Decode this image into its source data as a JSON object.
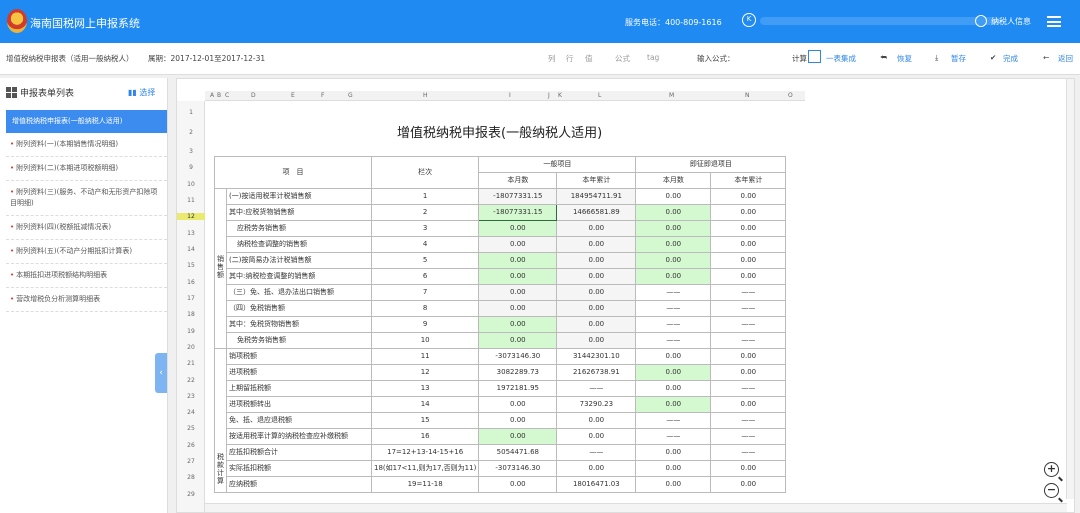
{
  "header": {
    "app_title": "海南国税网上申报系统",
    "phone": "服务电话：400-809-1616",
    "k_icon": "K",
    "user_label": "纳税人信息",
    "brand_color": "#1f8af2"
  },
  "toolbar": {
    "form_title": "增值税纳税申报表（适用一般纳税人）",
    "period": "属期：2017-12-01至2017-12-31",
    "col": "列",
    "row": "行",
    "val": "值",
    "formula": "公式",
    "tag": "tag",
    "input_formula": "输入公式：",
    "calc": "计算",
    "one_table": "一表集成",
    "restore": "恢复",
    "save": "暂存",
    "done": "完成",
    "back": "返回"
  },
  "sidebar": {
    "title": "申报表单列表",
    "choose": "选择",
    "items": [
      {
        "label": "增值税纳税申报表(一般纳税人适用)",
        "active": true
      },
      {
        "label": "附列资料(一)(本期销售情况明细)"
      },
      {
        "label": "附列资料(二)(本期进项税额明细)"
      },
      {
        "label": "附列资料(三)(服务、不动产和无形资产扣除项目明细)"
      },
      {
        "label": "附列资料(四)(税额抵减情况表)"
      },
      {
        "label": "附列资料(五)(不动产分期抵扣计算表)"
      },
      {
        "label": "本期抵扣进项税额结构明细表"
      },
      {
        "label": "营改增税负分析测算明细表"
      }
    ]
  },
  "sheet": {
    "columns": [
      "A",
      "B",
      "C",
      "D",
      "E",
      "F",
      "G",
      "H",
      "I",
      "J",
      "K",
      "L",
      "M",
      "N",
      "O"
    ],
    "row_numbers": [
      "1",
      "2",
      "3",
      "9",
      "10",
      "11",
      "12",
      "13",
      "14",
      "15",
      "16",
      "17",
      "18",
      "19",
      "20",
      "21",
      "22",
      "23",
      "24",
      "25",
      "26",
      "27",
      "28",
      "29"
    ],
    "selected_row": "12",
    "title": "增值税纳税申报表(一般纳税人适用)",
    "headers": {
      "item": "项　目",
      "line": "栏次",
      "general": "一般项目",
      "immediate": "即征即退项目",
      "month": "本月数",
      "year": "本年累计"
    },
    "sections": [
      {
        "label": "销售额",
        "rows": 10
      },
      {
        "label": "税款计算",
        "rows": 9
      }
    ],
    "rows": [
      {
        "item": "(一)按适用税率计税销售额",
        "line": "1",
        "v": [
          "-18077331.15",
          "184954711.91",
          "0.00",
          "0.00"
        ],
        "green": []
      },
      {
        "item": "其中:应税货物销售额",
        "line": "2",
        "v": [
          "-18077331.15",
          "14666581.89",
          "0.00",
          "0.00"
        ],
        "green": [
          0,
          2
        ],
        "selected": 0
      },
      {
        "item": "应税劳务销售额",
        "line": "3",
        "v": [
          "0.00",
          "0.00",
          "0.00",
          "0.00"
        ],
        "green": [
          0,
          2
        ],
        "indent": true
      },
      {
        "item": "纳税检查调整的销售额",
        "line": "4",
        "v": [
          "0.00",
          "0.00",
          "0.00",
          "0.00"
        ],
        "green": [
          2
        ],
        "indent": true
      },
      {
        "item": "(二)按简易办法计税销售额",
        "line": "5",
        "v": [
          "0.00",
          "0.00",
          "0.00",
          "0.00"
        ],
        "green": [
          0,
          2
        ]
      },
      {
        "item": "其中:纳税检查调整的销售额",
        "line": "6",
        "v": [
          "0.00",
          "0.00",
          "0.00",
          "0.00"
        ],
        "green": [
          0,
          2
        ]
      },
      {
        "item": "（三）免、抵、退办法出口销售额",
        "line": "7",
        "v": [
          "0.00",
          "0.00",
          "——",
          "——"
        ],
        "green": []
      },
      {
        "item": "（四）免税销售额",
        "line": "8",
        "v": [
          "0.00",
          "0.00",
          "——",
          "——"
        ],
        "green": []
      },
      {
        "item": "其中：免税货物销售额",
        "line": "9",
        "v": [
          "0.00",
          "0.00",
          "——",
          "——"
        ],
        "green": [
          0
        ]
      },
      {
        "item": "免税劳务销售额",
        "line": "10",
        "v": [
          "0.00",
          "0.00",
          "——",
          "——"
        ],
        "green": [
          0
        ],
        "indent": true
      },
      {
        "item": "销项税额",
        "line": "11",
        "v": [
          "-3073146.30",
          "31442301.10",
          "0.00",
          "0.00"
        ],
        "green": []
      },
      {
        "item": "进项税额",
        "line": "12",
        "v": [
          "3082289.73",
          "21626738.91",
          "0.00",
          "0.00"
        ],
        "green": [
          2
        ]
      },
      {
        "item": "上期留抵税额",
        "line": "13",
        "v": [
          "1972181.95",
          "——",
          "0.00",
          "——"
        ],
        "green": []
      },
      {
        "item": "进项税额转出",
        "line": "14",
        "v": [
          "0.00",
          "73290.23",
          "0.00",
          "0.00"
        ],
        "green": [
          2
        ]
      },
      {
        "item": "免、抵、退应退税额",
        "line": "15",
        "v": [
          "0.00",
          "0.00",
          "——",
          "——"
        ],
        "green": []
      },
      {
        "item": "按适用税率计算的纳税检查应补缴税额",
        "line": "16",
        "v": [
          "0.00",
          "0.00",
          "——",
          "——"
        ],
        "green": [
          0
        ]
      },
      {
        "item": "应抵扣税额合计",
        "line": "17=12+13-14-15+16",
        "v": [
          "5054471.68",
          "——",
          "0.00",
          "——"
        ],
        "green": []
      },
      {
        "item": "实际抵扣税额",
        "line": "18(如17<11,则为17,否则为11)",
        "v": [
          "-3073146.30",
          "0.00",
          "0.00",
          "0.00"
        ],
        "green": []
      },
      {
        "item": "应纳税额",
        "line": "19=11-18",
        "v": [
          "0.00",
          "18016471.03",
          "0.00",
          "0.00"
        ],
        "green": []
      }
    ],
    "highlight_color": "#d4f8d0"
  }
}
